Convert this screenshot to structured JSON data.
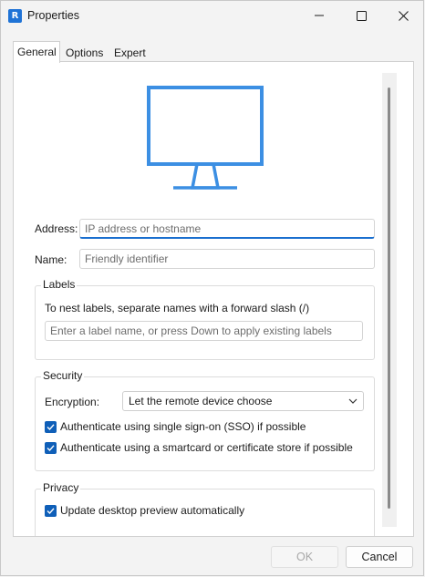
{
  "window": {
    "title": "Properties",
    "app_icon_glyph": "R",
    "controls": [
      "minimize-icon",
      "maximize-icon",
      "close-icon"
    ]
  },
  "tabs": [
    {
      "label": "General",
      "active": true
    },
    {
      "label": "Options",
      "active": false
    },
    {
      "label": "Expert",
      "active": false
    }
  ],
  "general": {
    "address": {
      "label": "Address:",
      "value": "",
      "placeholder": "IP address or hostname"
    },
    "name": {
      "label": "Name:",
      "value": "",
      "placeholder": "Friendly identifier"
    },
    "labels": {
      "legend": "Labels",
      "hint": "To nest labels, separate names with a forward slash (/)",
      "input_placeholder": "Enter a label name, or press Down to apply existing labels"
    },
    "security": {
      "legend": "Security",
      "encryption_label": "Encryption:",
      "encryption_value": "Let the remote device choose",
      "sso_label": "Authenticate using single sign-on (SSO) if possible",
      "sso_checked": true,
      "smartcard_label": "Authenticate using a smartcard or certificate store if possible",
      "smartcard_checked": true
    },
    "privacy": {
      "legend": "Privacy",
      "update_preview_label": "Update desktop preview automatically",
      "update_preview_checked": true
    }
  },
  "buttons": {
    "ok": "OK",
    "cancel": "Cancel"
  },
  "colors": {
    "accent": "#1a6fcf",
    "monitor": "#3c8fe3",
    "checkbox": "#0f5fb8"
  },
  "icons": {
    "hero": "monitor-icon"
  }
}
